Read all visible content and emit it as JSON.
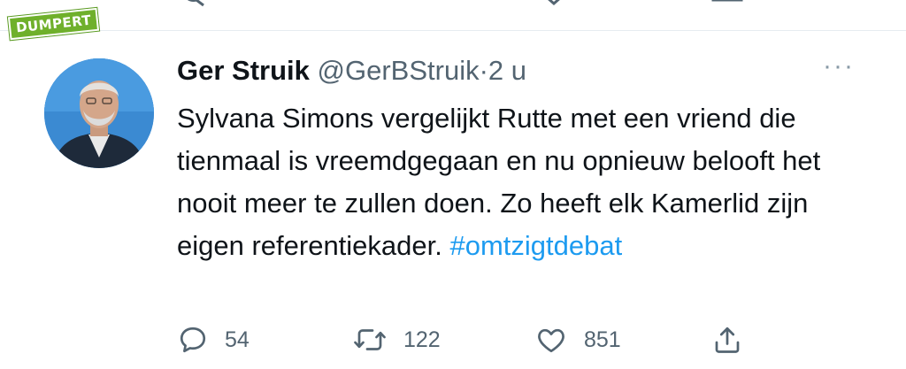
{
  "watermark": {
    "text": "DUMPERT"
  },
  "tweet": {
    "author_name": "Ger Struik",
    "handle": "@GerBStruik",
    "separator": "·",
    "time": "2 u",
    "text_body": "Sylvana Simons vergelijkt Rutte met een vriend die tienmaal is vreemdgegaan en nu opnieuw belooft het nooit meer te zullen doen. Zo heeft elk Kamerlid zijn eigen referentiekader.",
    "hashtag": "#omtzigtdebat",
    "more_label": "···"
  },
  "actions": [
    {
      "icon": "reply-icon",
      "count": "54"
    },
    {
      "icon": "retweet-icon",
      "count": "122"
    },
    {
      "icon": "like-icon",
      "count": "851"
    },
    {
      "icon": "share-icon"
    }
  ],
  "colors": {
    "accent": "#1d9bf0",
    "secondary_text": "#536471",
    "watermark_bg": "#6fb02b"
  }
}
